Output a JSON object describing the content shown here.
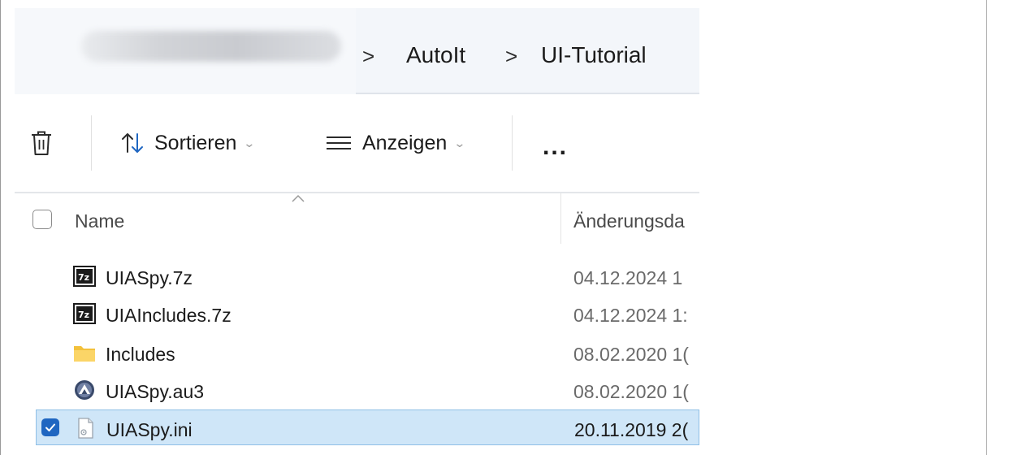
{
  "address_bar": {
    "blurred_segment": "",
    "crumbs": [
      "AutoIt",
      "UI-Tutorial"
    ],
    "separator": ">"
  },
  "toolbar": {
    "delete_icon": "trash-icon",
    "sort_label": "Sortieren",
    "sort_icon": "sort-arrows-icon",
    "view_label": "Anzeigen",
    "view_icon": "lines-icon",
    "more_label": "..."
  },
  "list": {
    "header": {
      "name_label": "Name",
      "date_label": "Änderungsda"
    },
    "rows": [
      {
        "name": "UIASpy.7z",
        "date": "04.12.2024 1",
        "icon": "7z-archive-icon",
        "selected": false
      },
      {
        "name": "UIAIncludes.7z",
        "date": "04.12.2024 1:",
        "icon": "7z-archive-icon",
        "selected": false
      },
      {
        "name": "Includes",
        "date": "08.02.2020 1(",
        "icon": "folder-icon",
        "selected": false
      },
      {
        "name": "UIASpy.au3",
        "date": "08.02.2020 1(",
        "icon": "autoit-script-icon",
        "selected": false
      },
      {
        "name": "UIASpy.ini",
        "date": "20.11.2019 2(",
        "icon": "ini-file-icon",
        "selected": true
      }
    ]
  },
  "colors": {
    "selection_bg": "#cfe6f8",
    "selection_border": "#8fbfe6",
    "checkbox_checked": "#1f66c1",
    "address_bg": "#f3f6fa"
  }
}
